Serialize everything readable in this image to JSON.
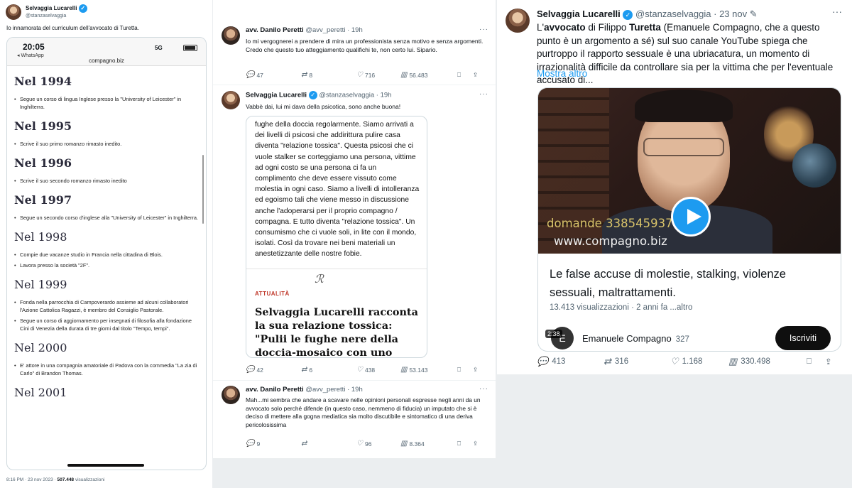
{
  "left_tweet": {
    "author": "Selvaggia Lucarelli",
    "handle": "@stanzaselvaggia",
    "text": "Io innamorata del curriculum dell'avvocato di Turetta.",
    "phone": {
      "time": "20:05",
      "back_app": "◂ WhatsApp",
      "signal": "5G",
      "url": "compagno.biz"
    },
    "cv": [
      {
        "year": "Nel 1994",
        "items": [
          "Segue un corso di lingua Inglese presso la \"University of Leicester\" in Inghilterra."
        ]
      },
      {
        "year": "Nel 1995",
        "items": [
          "Scrive il suo primo romanzo rimasto inedito."
        ]
      },
      {
        "year": "Nel 1996",
        "items": [
          "Scrive il suo secondo romanzo rimasto inedito"
        ]
      },
      {
        "year": "Nel 1997",
        "items": [
          "Segue un secondo corso d'inglese alla \"University of Leicester\" in Inghilterra."
        ]
      },
      {
        "year": "Nel 1998",
        "items": [
          "Compie due vacanze studio in Francia nella cittadina di Blois.",
          "Lavora presso la società \"2F\"."
        ]
      },
      {
        "year": "Nel 1999",
        "items": [
          "Fonda nella parrocchia di Campoverardo assieme ad alcuni collaboratori l'Azione Cattolica Ragazzi, è membro del Consiglio Pastorale.",
          "Segue un corso di aggiornamento per insegnati di filosofia alla fondazione Cini di Venezia della durata di tre giorni dal titolo \"Tempo, tempi\"."
        ]
      },
      {
        "year": "Nel 2000",
        "items": [
          "E' attore in una compagnia amatoriale di Padova con la commedia \"La zia di Carlo\" di Brandon Thomas."
        ]
      },
      {
        "year": "Nel 2001",
        "items": []
      }
    ],
    "footer_time": "8:16 PM · 23 nov 2023 · ",
    "footer_views": "507.448",
    "footer_views_label": " visualizzazioni"
  },
  "middle": {
    "reply1": {
      "author": "avv. Danilo Peretti",
      "handle": "@avv_peretti",
      "time": "19h",
      "text": "Io mi vergognerei a prendere di mira un professionista senza motivo e senza argomenti. Credo che questo tuo atteggiamento qualifichi te, non certo lui. Sipario.",
      "replies": "47",
      "reposts": "8",
      "likes": "716",
      "views": "56.483"
    },
    "reply2": {
      "author": "Selvaggia Lucarelli",
      "handle": "@stanzaselvaggia",
      "time": "19h",
      "text": "Vabbè dai, lui mi dava della psicotica, sono anche buona!",
      "quote_text": "fughe della doccia regolarmente. Siamo arrivati a dei livelli di psicosi che addirittura pulire casa diventa \"relazione tossica\". Questa psicosi che ci vuole stalker se corteggiamo una persona, vittime ad ogni costo se una persona ci fa un complimento che deve essere vissuto come molestia in ogni caso. Siamo a livelli di intolleranza ed egoismo tali che viene messo in discussione anche l'adoperarsi per il proprio compagno / compagna. E tutto diventa \"relazione tossica\". Un consumismo che ci vuole soli, in lite con il mondo, isolati. Così da trovare nei beni materiali un anestetizzante delle nostre fobie.",
      "article_tag": "ATTUALITÀ",
      "article_title": "Selvaggia Lucarelli racconta la sua relazione tossica: \"Pulii le fughe nere della doccia-mosaico con uno spazzolino per soddisfare una sua",
      "replies": "42",
      "reposts": "6",
      "likes": "438",
      "views": "53.143"
    },
    "reply3": {
      "author": "avv. Danilo Peretti",
      "handle": "@avv_peretti",
      "time": "19h",
      "text": "Mah...mi sembra che andare a scavare nelle opinioni personali espresse negli anni da un avvocato solo perché difende (in questo caso, nemmeno di fiducia) un imputato che si è deciso di mettere alla gogna mediatica sia molto discutibile e sintomatico di una deriva pericolosissima",
      "replies": "9",
      "reposts": "",
      "likes": "96",
      "views": "8.364"
    }
  },
  "right_tweet": {
    "author": "Selvaggia Lucarelli",
    "handle": "@stanzaselvaggia",
    "time": "23 nov",
    "text_pre": "L'",
    "text_b1": "avvocato",
    "text_mid": " di Filippo ",
    "text_b2": "Turetta",
    "text_post": " (Emanuele Compagno, che a questo punto è un argomento a sé) sul suo canale YouTube spiega che purtroppo il rapporto sessuale è una ubriacatura, un momento di irrazionalità difficile da controllare sia per la vittima che per l'eventuale accusato di...",
    "show_more": "Mostra altro",
    "video": {
      "overlay_phone": "domande 3385459374",
      "overlay_url": "www.compagno.biz",
      "title": "Le false accuse di molestie, stalking, violenze sessuali, maltrattamenti.",
      "meta": "13.413 visualizzazioni · 2 anni fa  ...altro",
      "duration": "2:38",
      "channel_initial": "E",
      "channel": "Emanuele Compagno",
      "subs": "327",
      "subscribe": "Iscriviti"
    },
    "replies": "413",
    "reposts": "316",
    "likes": "1.168",
    "views": "330.498"
  },
  "icons": {
    "more": "···",
    "reply": "💬",
    "repost": "⇄",
    "like": "♡",
    "views": "▥",
    "bookmark": "⎕",
    "share": "⇪",
    "verified": "✓",
    "edit": "✎"
  },
  "colors": {
    "accent": "#1d9bf0",
    "muted": "#536471",
    "article_tag": "#c0392b"
  }
}
